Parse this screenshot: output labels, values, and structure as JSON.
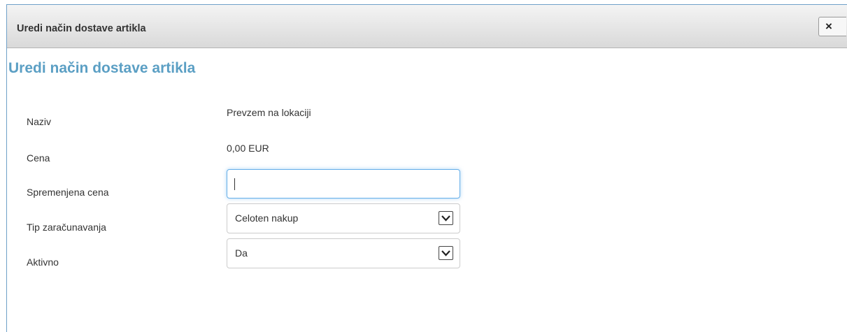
{
  "dialog": {
    "title": "Uredi način dostave artikla",
    "close_label": "×",
    "heading": "Uredi način dostave artikla"
  },
  "form": {
    "naziv": {
      "label": "Naziv",
      "value": "Prevzem na lokaciji"
    },
    "cena": {
      "label": "Cena",
      "value": "0,00 EUR"
    },
    "spremenjena_cena": {
      "label": "Spremenjena cena",
      "value": ""
    },
    "tip_zaracunavanja": {
      "label": "Tip zaračunavanja",
      "selected": "Celoten nakup"
    },
    "aktivno": {
      "label": "Aktivno",
      "selected": "Da"
    }
  },
  "icons": {
    "close": "close-icon",
    "dropdown": "chevron-down-icon"
  },
  "colors": {
    "heading": "#5b9fc4",
    "dialog_border": "#6fa0c8",
    "input_focus": "#66afe9"
  }
}
